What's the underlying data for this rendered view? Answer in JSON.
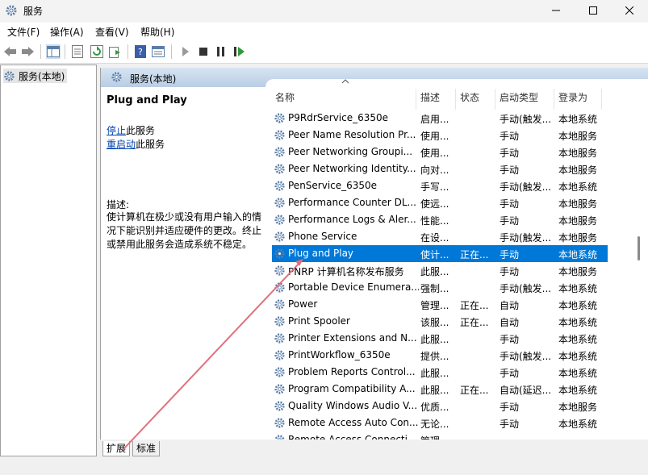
{
  "window": {
    "title": "服务"
  },
  "menu": [
    "文件(F)",
    "操作(A)",
    "查看(V)",
    "帮助(H)"
  ],
  "tree": {
    "root_label": "服务(本地)"
  },
  "content": {
    "header_title": "服务(本地)"
  },
  "description": {
    "service_name": "Plug and Play",
    "stop_link": "停止",
    "stop_suffix": "此服务",
    "restart_link": "重启动",
    "restart_suffix": "此服务",
    "desc_label": "描述:",
    "desc_text": "使计算机在极少或没有用户输入的情况下能识别并适应硬件的更改。终止或禁用此服务会造成系统不稳定。"
  },
  "columns": {
    "name": "名称",
    "desc": "描述",
    "status": "状态",
    "startup": "启动类型",
    "logon": "登录为"
  },
  "services": [
    {
      "name": "P9RdrService_6350e",
      "desc": "启用...",
      "status": "",
      "startup": "手动(触发...",
      "logon": "本地系统"
    },
    {
      "name": "Peer Name Resolution Pr...",
      "desc": "使用...",
      "status": "",
      "startup": "手动",
      "logon": "本地服务"
    },
    {
      "name": "Peer Networking Groupi...",
      "desc": "使用...",
      "status": "",
      "startup": "手动",
      "logon": "本地服务"
    },
    {
      "name": "Peer Networking Identity...",
      "desc": "向对...",
      "status": "",
      "startup": "手动",
      "logon": "本地服务"
    },
    {
      "name": "PenService_6350e",
      "desc": "手写...",
      "status": "",
      "startup": "手动(触发...",
      "logon": "本地系统"
    },
    {
      "name": "Performance Counter DL...",
      "desc": "使远...",
      "status": "",
      "startup": "手动",
      "logon": "本地服务"
    },
    {
      "name": "Performance Logs & Aler...",
      "desc": "性能...",
      "status": "",
      "startup": "手动",
      "logon": "本地服务"
    },
    {
      "name": "Phone Service",
      "desc": "在设...",
      "status": "",
      "startup": "手动(触发...",
      "logon": "本地服务"
    },
    {
      "name": "Plug and Play",
      "desc": "使计...",
      "status": "正在...",
      "startup": "手动",
      "logon": "本地系统",
      "selected": true
    },
    {
      "name": "PNRP 计算机名称发布服务",
      "desc": "此服...",
      "status": "",
      "startup": "手动",
      "logon": "本地服务"
    },
    {
      "name": "Portable Device Enumera...",
      "desc": "强制...",
      "status": "",
      "startup": "手动(触发...",
      "logon": "本地系统"
    },
    {
      "name": "Power",
      "desc": "管理...",
      "status": "正在...",
      "startup": "自动",
      "logon": "本地系统"
    },
    {
      "name": "Print Spooler",
      "desc": "该服...",
      "status": "正在...",
      "startup": "自动",
      "logon": "本地系统"
    },
    {
      "name": "Printer Extensions and N...",
      "desc": "此服...",
      "status": "",
      "startup": "手动",
      "logon": "本地系统"
    },
    {
      "name": "PrintWorkflow_6350e",
      "desc": "提供...",
      "status": "",
      "startup": "手动(触发...",
      "logon": "本地系统"
    },
    {
      "name": "Problem Reports Control...",
      "desc": "此服...",
      "status": "",
      "startup": "手动",
      "logon": "本地系统"
    },
    {
      "name": "Program Compatibility A...",
      "desc": "此服...",
      "status": "正在...",
      "startup": "自动(延迟...",
      "logon": "本地系统"
    },
    {
      "name": "Quality Windows Audio V...",
      "desc": "优质...",
      "status": "",
      "startup": "手动",
      "logon": "本地服务"
    },
    {
      "name": "Remote Access Auto Con...",
      "desc": "无论...",
      "status": "",
      "startup": "手动",
      "logon": "本地系统"
    },
    {
      "name": "Remote Access Connecti...",
      "desc": "管理...",
      "status": "",
      "startup": "",
      "logon": ""
    }
  ],
  "tabs": [
    "扩展",
    "标准"
  ],
  "colors": {
    "selection": "#0078d7",
    "annotation_arrow": "#e0707a",
    "link": "#0645ad"
  },
  "icons": [
    "services-app-icon",
    "back-icon",
    "forward-icon",
    "show-tree-icon",
    "properties-icon",
    "refresh-icon",
    "export-icon",
    "help-icon",
    "console-icon",
    "start-icon",
    "stop-icon",
    "pause-icon",
    "restart-icon",
    "gear-icon"
  ]
}
